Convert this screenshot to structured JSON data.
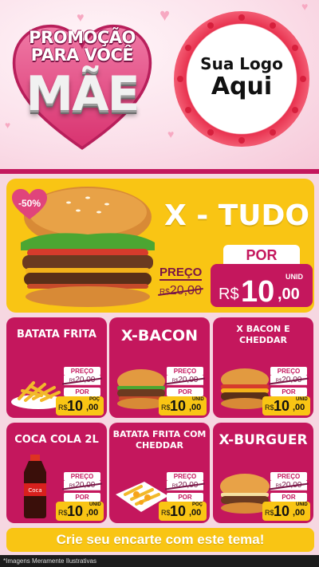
{
  "header": {
    "promo_line1": "PROMOÇÃO",
    "promo_line2": "PARA VOCÊ",
    "promo_line3": "MÃE",
    "logo_line1": "Sua Logo",
    "logo_line2": "Aqui"
  },
  "feature": {
    "discount": "-50%",
    "name": "X - TUDO",
    "preco_label": "PREÇO",
    "old_currency": "R$",
    "old_price": "20,00",
    "por_label": "POR",
    "currency": "R$",
    "price_int": "10",
    "price_cents": ",00",
    "unit": "UNID"
  },
  "cards": [
    {
      "title": "BATATA FRITA",
      "preco_label": "PREÇO",
      "old_currency": "R$",
      "old_price": "20,00",
      "por_label": "POR",
      "currency": "R$",
      "price_int": "10",
      "price_cents": ",00",
      "unit": "POÇ"
    },
    {
      "title": "X-BACON",
      "preco_label": "PREÇO",
      "old_currency": "R$",
      "old_price": "20,00",
      "por_label": "POR",
      "currency": "R$",
      "price_int": "10",
      "price_cents": ",00",
      "unit": "UNID"
    },
    {
      "title": "X BACON E CHEDDAR",
      "preco_label": "PREÇO",
      "old_currency": "R$",
      "old_price": "20,00",
      "por_label": "POR",
      "currency": "R$",
      "price_int": "10",
      "price_cents": ",00",
      "unit": "UNID"
    },
    {
      "title": "COCA COLA 2L",
      "preco_label": "PREÇO",
      "old_currency": "R$",
      "old_price": "20,00",
      "por_label": "POR",
      "currency": "R$",
      "price_int": "10",
      "price_cents": ",00",
      "unit": "UNID"
    },
    {
      "title": "BATATA FRITA COM CHEDDAR",
      "preco_label": "PREÇO",
      "old_currency": "R$",
      "old_price": "20,00",
      "por_label": "POR",
      "currency": "R$",
      "price_int": "10",
      "price_cents": ",00",
      "unit": "POÇ"
    },
    {
      "title": "X-BURGUER",
      "preco_label": "PREÇO",
      "old_currency": "R$",
      "old_price": "20,00",
      "por_label": "POR",
      "currency": "R$",
      "price_int": "10",
      "price_cents": ",00",
      "unit": "UNID"
    }
  ],
  "cta": "Crie seu encarte com este tema!",
  "footer": "*Imagens Meramente Ilustrativas",
  "colors": {
    "magenta": "#c4175d",
    "yellow": "#f9c514",
    "pink_bg": "#fbe3ec",
    "heart_red": "#e8324f"
  },
  "icons": [
    "heart-icon",
    "burger-image",
    "fries-image",
    "soda-bottle-image"
  ]
}
